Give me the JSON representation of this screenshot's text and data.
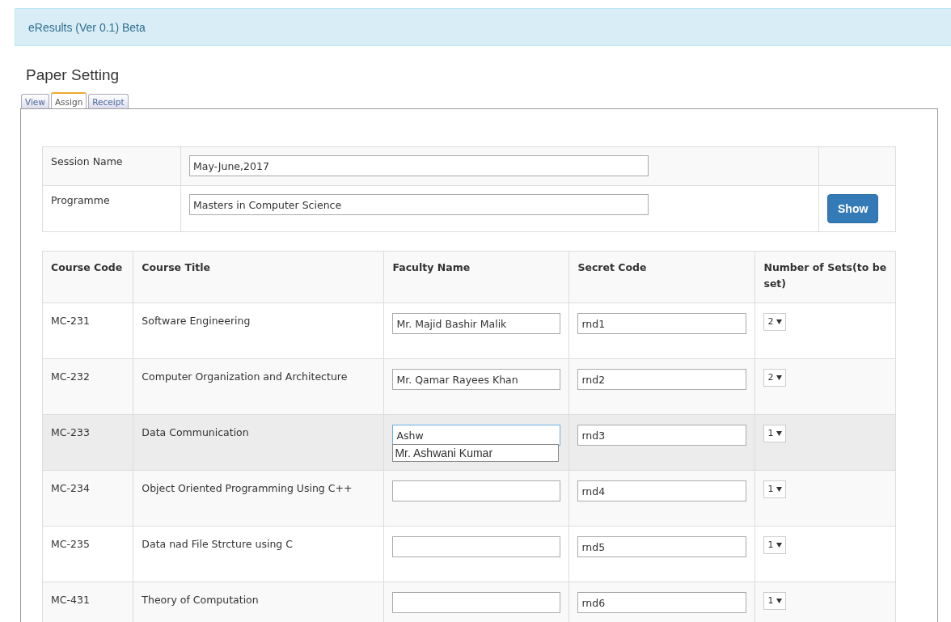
{
  "header": {
    "title": "eResults (Ver 0.1) Beta"
  },
  "page_title": "Paper Setting",
  "tabs": [
    {
      "label": "View",
      "selected": false
    },
    {
      "label": "Assign",
      "selected": true
    },
    {
      "label": "Receipt",
      "selected": false
    }
  ],
  "form": {
    "fields": [
      {
        "label": "Session Name",
        "value": "May-June,2017"
      },
      {
        "label": "Programme",
        "value": "Masters in Computer Science"
      }
    ],
    "button": "Show"
  },
  "table": {
    "columns": [
      "Course Code",
      "Course Title",
      "Faculty Name",
      "Secret Code",
      "Number of Sets(to be set)"
    ],
    "rows": [
      {
        "code": "MC-231",
        "title": "Software Engineering",
        "faculty": {
          "value": "Mr. Majid Bashir Malik",
          "focused": false
        },
        "secret": "rnd1",
        "sets": "2",
        "hovered": false
      },
      {
        "code": "MC-232",
        "title": "Computer Organization and Architecture",
        "faculty": {
          "value": "Mr. Qamar Rayees Khan",
          "focused": false
        },
        "secret": "rnd2",
        "sets": "2",
        "hovered": false
      },
      {
        "code": "MC-233",
        "title": "Data Communication",
        "faculty": {
          "value": "Ashw",
          "focused": true,
          "suggestions": [
            "Mr. Ashwani Kumar"
          ]
        },
        "secret": "rnd3",
        "sets": "1",
        "hovered": true
      },
      {
        "code": "MC-234",
        "title": "Object Oriented Programming Using C++",
        "faculty": {
          "focused": false
        },
        "secret": "rnd4",
        "sets": "1",
        "hovered": false
      },
      {
        "code": "MC-235",
        "title": "Data nad File Strcture using C",
        "faculty": {
          "focused": false
        },
        "secret": "rnd5",
        "sets": "1",
        "hovered": false
      },
      {
        "code": "MC-431",
        "title": "Theory of Computation",
        "faculty": {
          "focused": false
        },
        "secret": "rnd6",
        "sets": "1",
        "hovered": false
      }
    ]
  }
}
